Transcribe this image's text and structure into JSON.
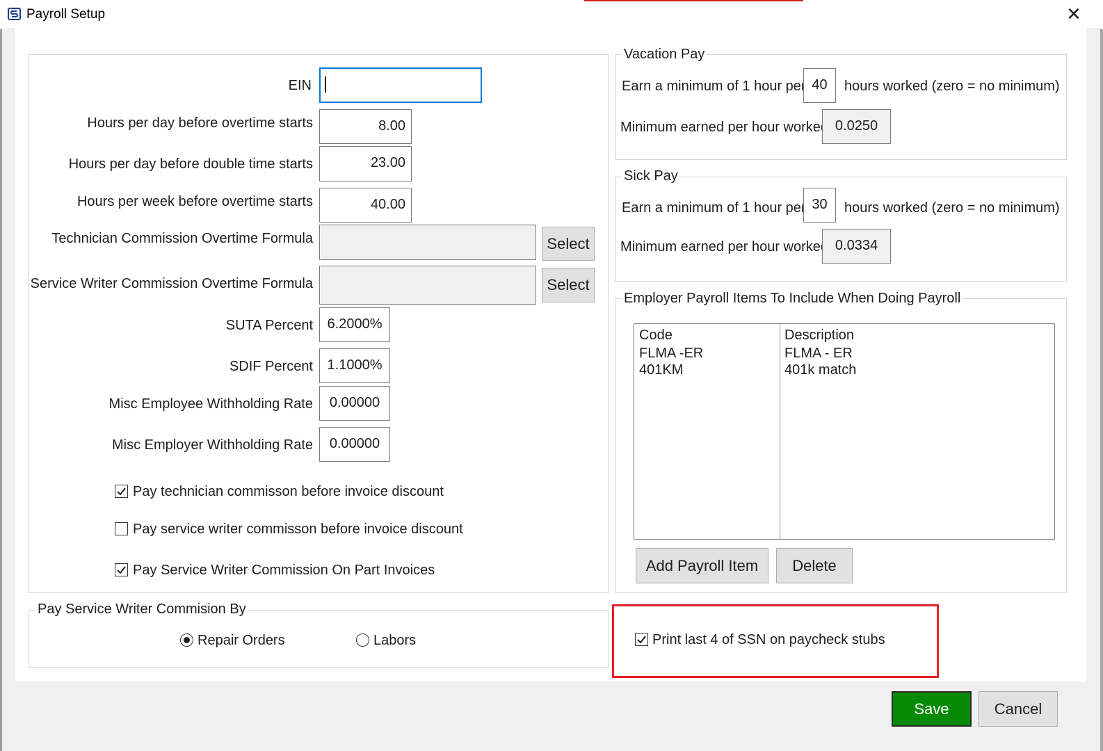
{
  "window": {
    "title": "Payroll Setup",
    "close_icon": "close-icon"
  },
  "fields": {
    "ein": {
      "label": "EIN",
      "value": ""
    },
    "overtime_day": {
      "label": "Hours per day before overtime starts",
      "value": "8.00"
    },
    "double_time_day": {
      "label": "Hours per day before double time starts",
      "value": "23.00"
    },
    "overtime_week": {
      "label": "Hours per week before overtime starts",
      "value": "40.00"
    },
    "tech_formula": {
      "label": "Technician Commission Overtime Formula",
      "value": "",
      "button": "Select"
    },
    "sw_formula": {
      "label": "Service Writer Commission Overtime Formula",
      "value": "",
      "button": "Select"
    },
    "suta": {
      "label": "SUTA Percent",
      "value": "6.2000%"
    },
    "sdif": {
      "label": "SDIF Percent",
      "value": "1.1000%"
    },
    "misc_employee": {
      "label": "Misc Employee Withholding Rate",
      "value": "0.00000"
    },
    "misc_employer": {
      "label": "Misc Employer Withholding Rate",
      "value": "0.00000"
    }
  },
  "checkboxes": {
    "tech_before_discount": {
      "label": "Pay technician commisson before invoice discount",
      "checked": true
    },
    "sw_before_discount": {
      "label": "Pay service writer commisson before invoice discount",
      "checked": false
    },
    "sw_on_part_invoices": {
      "label": "Pay Service Writer Commission On Part Invoices",
      "checked": true
    },
    "print_ssn": {
      "label": "Print last 4 of SSN on paycheck stubs",
      "checked": true
    }
  },
  "pay_by": {
    "legend": "Pay Service Writer Commision By",
    "options": [
      {
        "label": "Repair Orders",
        "selected": true
      },
      {
        "label": "Labors",
        "selected": false
      }
    ]
  },
  "vacation": {
    "legend": "Vacation Pay",
    "earn_prefix": "Earn a minimum of 1 hour per",
    "hours": "40",
    "earn_suffix": "hours worked  (zero = no minimum)",
    "min_label": "Minimum earned per hour worked",
    "min_value": "0.0250"
  },
  "sick": {
    "legend": "Sick Pay",
    "earn_prefix": "Earn a minimum of 1 hour per",
    "hours": "30",
    "earn_suffix": "hours worked  (zero = no minimum)",
    "min_label": "Minimum earned per hour worked",
    "min_value": "0.0334"
  },
  "employer_items": {
    "legend": "Employer Payroll Items To Include When Doing Payroll",
    "columns": [
      "Code",
      "Description"
    ],
    "rows": [
      [
        "FLMA -ER",
        "FLMA - ER"
      ],
      [
        "401KM",
        "401k match"
      ]
    ],
    "add_button": "Add Payroll Item",
    "delete_button": "Delete"
  },
  "footer": {
    "save": "Save",
    "cancel": "Cancel"
  },
  "colors": {
    "save_bg": "#068a06",
    "highlight": "#e4202a",
    "focus": "#0078d7"
  }
}
